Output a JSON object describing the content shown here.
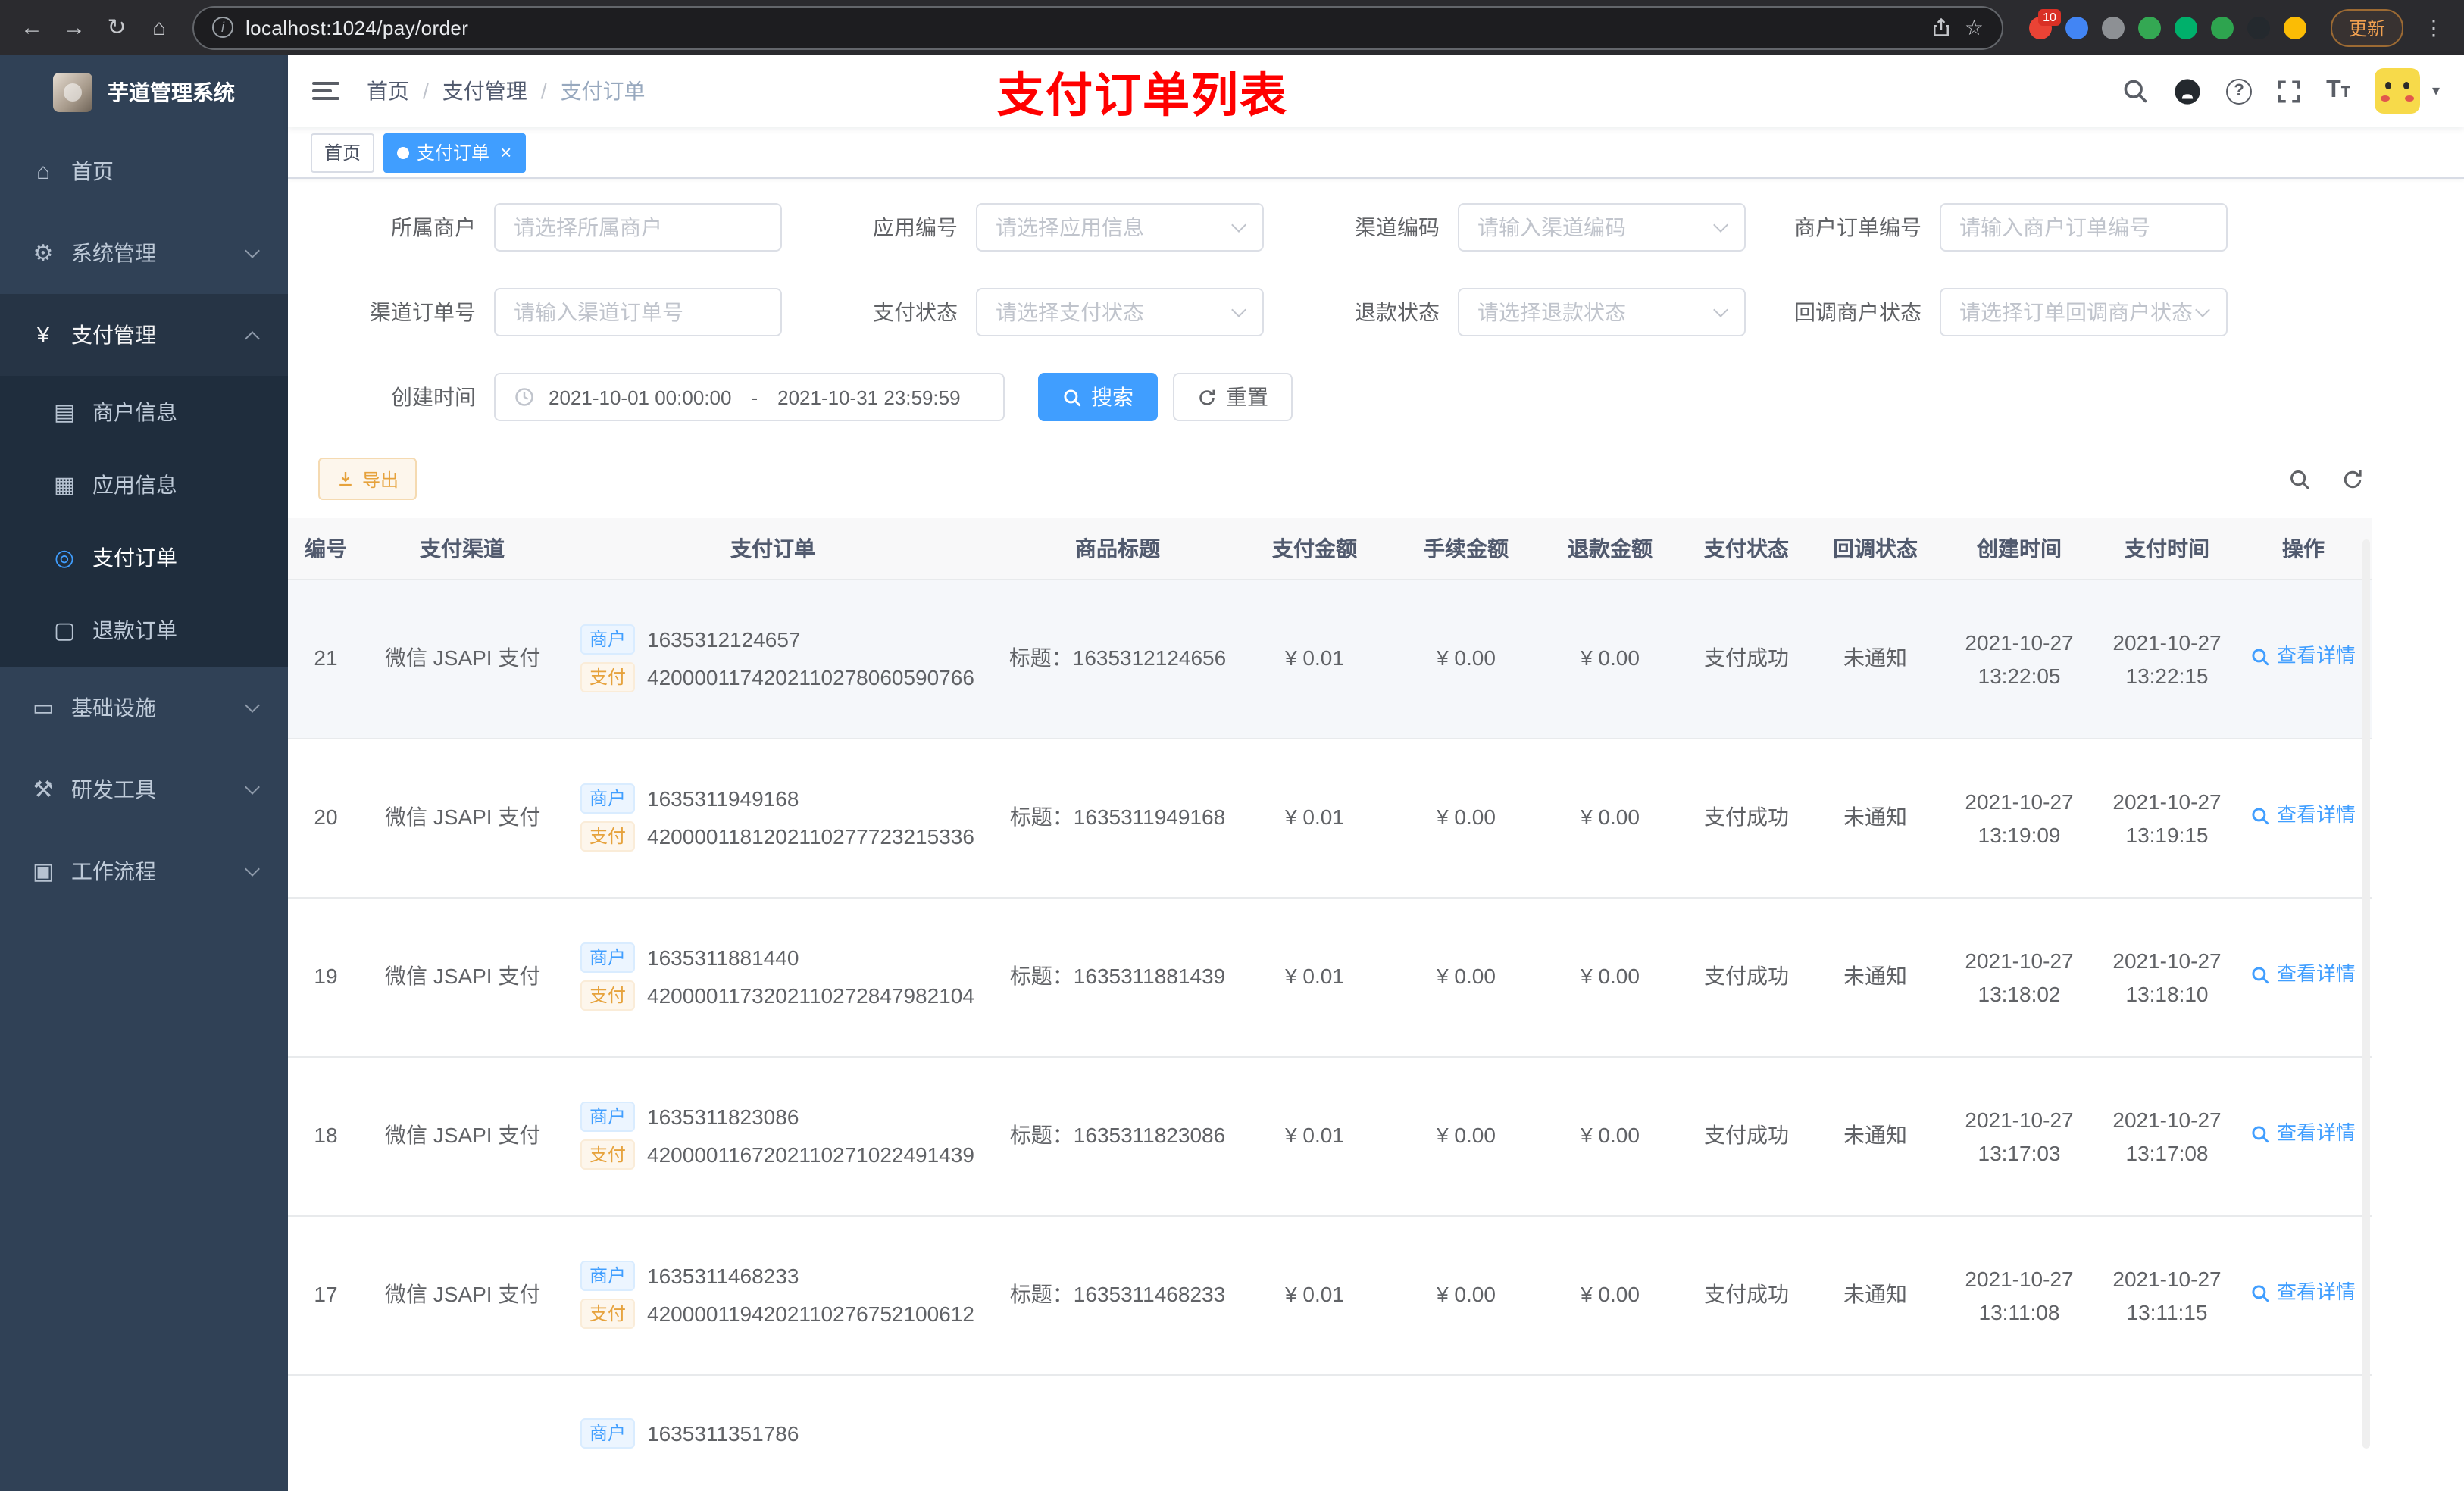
{
  "browser": {
    "url": "localhost:1024/pay/order",
    "update_button": "更新",
    "extensions": [
      {
        "name": "extension-red",
        "color": "#ea4335",
        "badge": "10"
      },
      {
        "name": "extension-blue-drop",
        "color": "#4285f4",
        "badge": ""
      },
      {
        "name": "extension-gray",
        "color": "#8d9094",
        "badge": ""
      },
      {
        "name": "extension-green",
        "color": "#34a853",
        "badge": ""
      },
      {
        "name": "extension-check-green",
        "color": "#00b06b",
        "badge": ""
      },
      {
        "name": "extension-chat-green",
        "color": "#2ea44f",
        "badge": ""
      },
      {
        "name": "extension-dark",
        "color": "#24292e",
        "badge": ""
      },
      {
        "name": "extension-face-yellow",
        "color": "#fbbc05",
        "badge": ""
      }
    ]
  },
  "icons": {
    "back": "←",
    "forward": "→",
    "reload": "↻",
    "home": "⌂",
    "star": "☆",
    "kebab": "⋮",
    "info": "i",
    "caret": "▾",
    "question": "?",
    "close": "×",
    "dashboard": "⌂",
    "system": "⚙",
    "pay": "¥",
    "merchant": "▤",
    "app": "▦",
    "order": "◎",
    "refund": "▢",
    "infra": "▭",
    "devtool": "⚒",
    "workflow": "▣"
  },
  "sidebar": {
    "logo_title": "芋道管理系统",
    "items": [
      {
        "label": "首页"
      },
      {
        "label": "系统管理"
      },
      {
        "label": "支付管理",
        "children": [
          {
            "label": "商户信息"
          },
          {
            "label": "应用信息"
          },
          {
            "label": "支付订单"
          },
          {
            "label": "退款订单"
          }
        ]
      },
      {
        "label": "基础设施"
      },
      {
        "label": "研发工具"
      },
      {
        "label": "工作流程"
      }
    ]
  },
  "header": {
    "breadcrumb": [
      "首页",
      "支付管理",
      "支付订单"
    ],
    "breadcrumb_separator": "/",
    "page_heading": "支付订单列表",
    "fontsize_icon_big": "T",
    "fontsize_icon_small": "T"
  },
  "tabs": [
    {
      "label": "首页"
    },
    {
      "label": "支付订单"
    }
  ],
  "form": {
    "fields": [
      {
        "label": "所属商户",
        "placeholder": "请选择所属商户"
      },
      {
        "label": "应用编号",
        "placeholder": "请选择应用信息"
      },
      {
        "label": "渠道编码",
        "placeholder": "请输入渠道编码"
      },
      {
        "label": "商户订单编号",
        "placeholder": "请输入商户订单编号"
      },
      {
        "label": "渠道订单号",
        "placeholder": "请输入渠道订单号"
      },
      {
        "label": "支付状态",
        "placeholder": "请选择支付状态"
      },
      {
        "label": "退款状态",
        "placeholder": "请选择退款状态"
      },
      {
        "label": "回调商户状态",
        "placeholder": "请选择订单回调商户状态"
      }
    ],
    "date_field": {
      "label": "创建时间",
      "start": "2021-10-01 00:00:00",
      "separator": "-",
      "end": "2021-10-31 23:59:59"
    },
    "search_button": "搜索",
    "reset_button": "重置"
  },
  "toolbar": {
    "export_button": "导出"
  },
  "table": {
    "columns": [
      "编号",
      "支付渠道",
      "支付订单",
      "商品标题",
      "支付金额",
      "手续金额",
      "退款金额",
      "支付状态",
      "回调状态",
      "创建时间",
      "支付时间",
      "操作"
    ],
    "badge_merchant": "商户",
    "badge_pay": "支付",
    "action_label": "查看详情",
    "rows": [
      {
        "id": "21",
        "channel": "微信 JSAPI 支付",
        "merchant_no": "1635312124657",
        "pay_no": "4200001174202110278060590766",
        "title": "标题：1635312124656",
        "amount": "¥ 0.01",
        "fee": "¥ 0.00",
        "refund": "¥ 0.00",
        "status": "支付成功",
        "notify": "未通知",
        "created_date": "2021-10-27",
        "created_time": "13:22:05",
        "paid_date": "2021-10-27",
        "paid_time": "13:22:15"
      },
      {
        "id": "20",
        "channel": "微信 JSAPI 支付",
        "merchant_no": "1635311949168",
        "pay_no": "4200001181202110277723215336",
        "title": "标题：1635311949168",
        "amount": "¥ 0.01",
        "fee": "¥ 0.00",
        "refund": "¥ 0.00",
        "status": "支付成功",
        "notify": "未通知",
        "created_date": "2021-10-27",
        "created_time": "13:19:09",
        "paid_date": "2021-10-27",
        "paid_time": "13:19:15"
      },
      {
        "id": "19",
        "channel": "微信 JSAPI 支付",
        "merchant_no": "1635311881440",
        "pay_no": "4200001173202110272847982104",
        "title": "标题：1635311881439",
        "amount": "¥ 0.01",
        "fee": "¥ 0.00",
        "refund": "¥ 0.00",
        "status": "支付成功",
        "notify": "未通知",
        "created_date": "2021-10-27",
        "created_time": "13:18:02",
        "paid_date": "2021-10-27",
        "paid_time": "13:18:10"
      },
      {
        "id": "18",
        "channel": "微信 JSAPI 支付",
        "merchant_no": "1635311823086",
        "pay_no": "4200001167202110271022491439",
        "title": "标题：1635311823086",
        "amount": "¥ 0.01",
        "fee": "¥ 0.00",
        "refund": "¥ 0.00",
        "status": "支付成功",
        "notify": "未通知",
        "created_date": "2021-10-27",
        "created_time": "13:17:03",
        "paid_date": "2021-10-27",
        "paid_time": "13:17:08"
      },
      {
        "id": "17",
        "channel": "微信 JSAPI 支付",
        "merchant_no": "1635311468233",
        "pay_no": "4200001194202110276752100612",
        "title": "标题：1635311468233",
        "amount": "¥ 0.01",
        "fee": "¥ 0.00",
        "refund": "¥ 0.00",
        "status": "支付成功",
        "notify": "未通知",
        "created_date": "2021-10-27",
        "created_time": "13:11:08",
        "paid_date": "2021-10-27",
        "paid_time": "13:11:15"
      },
      {
        "id": "",
        "channel": "",
        "merchant_no": "1635311351786",
        "pay_no": "",
        "title": "",
        "amount": "",
        "fee": "",
        "refund": "",
        "status": "",
        "notify": "",
        "created_date": "",
        "created_time": "",
        "paid_date": "",
        "paid_time": "",
        "partial": true
      }
    ]
  }
}
